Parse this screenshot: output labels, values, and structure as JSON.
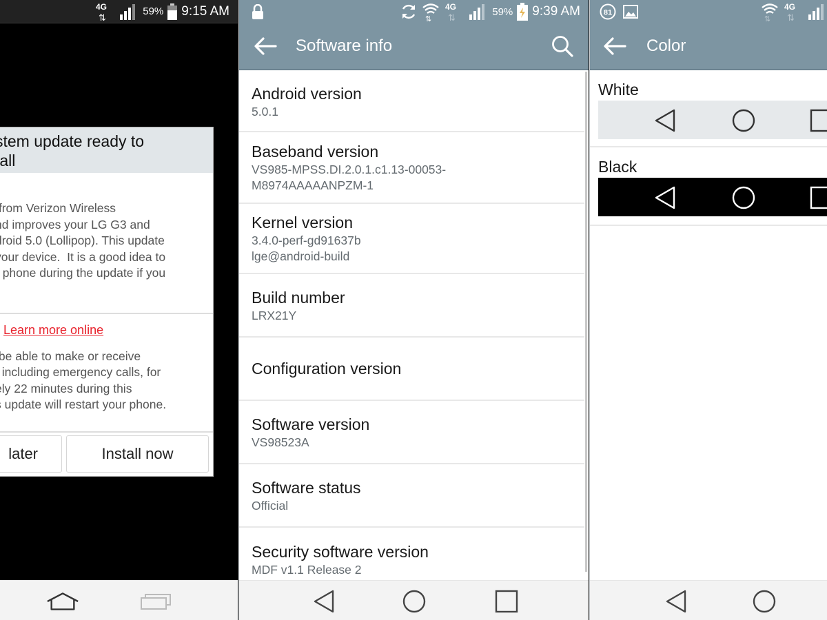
{
  "panel1": {
    "status": {
      "network": "4G LTE",
      "battery_pct": "59%",
      "time": "9:15 AM"
    },
    "dialog": {
      "title": "stem update ready to\ntall",
      "body_lines": [
        " from Verizon Wireless",
        "nd improves your LG G3 and",
        "droid 5.0 (Lollipop). This update",
        "your device.  It is a good idea to",
        "r phone during the update if you"
      ],
      "link": "Learn more online",
      "warning_lines": [
        " be able to make or receive",
        ", including emergency calls, for",
        "ely 22 minutes during this",
        "s update will restart your phone."
      ],
      "buttons": {
        "later": "later",
        "install": "Install now"
      }
    },
    "navbar": {
      "home": "home-icon",
      "recents": "recents-icon"
    }
  },
  "panel2": {
    "status": {
      "battery_pct": "59%",
      "time": "9:39 AM"
    },
    "toolbar": {
      "title": "Software info",
      "back": "back-arrow-icon",
      "search": "search-icon"
    },
    "items": [
      {
        "title": "Android version",
        "summary": "5.0.1"
      },
      {
        "title": "Baseband version",
        "summary": "VS985-MPSS.DI.2.0.1.c1.13-00053-\nM8974AAAAANPZM-1"
      },
      {
        "title": "Kernel version",
        "summary": "3.4.0-perf-gd91637b\nlge@android-build"
      },
      {
        "title": "Build number",
        "summary": "LRX21Y"
      },
      {
        "title": "Configuration version",
        "summary": ""
      },
      {
        "title": "Software version",
        "summary": "VS98523A"
      },
      {
        "title": "Software status",
        "summary": "Official"
      },
      {
        "title": "Security software version",
        "summary": "MDF v1.1 Release 2"
      }
    ]
  },
  "panel3": {
    "status": {
      "notification_badge": "81"
    },
    "toolbar": {
      "title": "Color"
    },
    "options": [
      {
        "label": "White",
        "bg": "#e6e9eb",
        "fg": "#333333"
      },
      {
        "label": "Black",
        "bg": "#000000",
        "fg": "#ffffff"
      }
    ]
  },
  "colors": {
    "toolbar": "#7d95a2",
    "link": "#e8232d"
  }
}
